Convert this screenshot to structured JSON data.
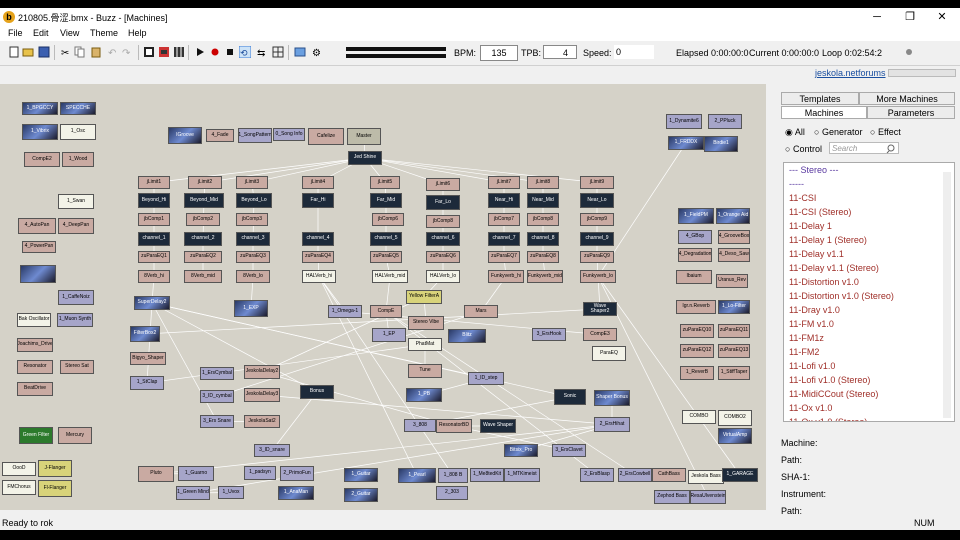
{
  "window": {
    "title": "210805.骨涩.bmx - Buzz - [Machines]",
    "minimize": "─",
    "maximize": "❐",
    "close": "✕"
  },
  "menu": [
    "File",
    "Edit",
    "View",
    "Theme",
    "Help"
  ],
  "toolbar": {
    "bpm_label": "BPM:",
    "bpm_value": "135",
    "tpb_label": "TPB:",
    "tpb_value": "4",
    "speed_label": "Speed:",
    "speed_value": "0",
    "elapsed": "Elapsed 0:00:00:0",
    "current": "Current 0:00:00:0",
    "loop": "Loop 0:02:54:2"
  },
  "links": {
    "site": "jeskola.net",
    "forums": "forums"
  },
  "panel": {
    "tabs_top": [
      "Templates",
      "More Machines"
    ],
    "tabs_bottom": [
      "Machines",
      "Parameters"
    ],
    "filters": [
      "All",
      "Generator",
      "Effect",
      "Control"
    ],
    "search_placeholder": "Search",
    "list": [
      "--- Stereo ---",
      "-----",
      "11-CSI",
      "11-CSI (Stereo)",
      "11-Delay 1",
      "11-Delay 1 (Stereo)",
      "11-Delay v1.1",
      "11-Delay v1.1 (Stereo)",
      "11-Distortion v1.0",
      "11-Distortion v1.0 (Stereo)",
      "11-Dray v1.0",
      "11-FM v1.0",
      "11-FM1z",
      "11-FM2",
      "11-Lofi v1.0",
      "11-Lofi v1.0 (Stereo)",
      "11-MidiCCout (Stereo)",
      "11-Ox v1.0",
      "11-Ox v1.0 (Stereo)"
    ],
    "info_labels": [
      "Machine:",
      "Path:",
      "SHA-1:",
      "Instrument:",
      "Path:"
    ]
  },
  "status": {
    "left": "Ready to rok",
    "right": "NUM"
  },
  "machines": [
    {
      "l": "1_BPGCCY",
      "k": "img"
    },
    {
      "l": "SPECCHE",
      "k": "img"
    },
    {
      "l": "1_Vibrix",
      "k": "img"
    },
    {
      "l": "1_Osc",
      "k": "wht"
    },
    {
      "l": "CompE2",
      "k": "eff"
    },
    {
      "l": "1_Wood",
      "k": "eff"
    },
    {
      "l": "1_Swan",
      "k": "wht"
    },
    {
      "l": "4_AutoPan",
      "k": "eff"
    },
    {
      "l": "4_DeepPan",
      "k": "eff"
    },
    {
      "l": "4_PowerPan",
      "k": "eff"
    },
    {
      "l": "",
      "k": "img"
    },
    {
      "l": "1_CaffeNoiz",
      "k": "gen"
    },
    {
      "l": "Bak Oscillator",
      "k": "wht"
    },
    {
      "l": "1_Muon Synth",
      "k": "gen"
    },
    {
      "l": "Joachims_Drive",
      "k": "eff"
    },
    {
      "l": "Resonator",
      "k": "eff"
    },
    {
      "l": "Stereo Sat",
      "k": "eff"
    },
    {
      "l": "BeatDrive",
      "k": "eff"
    },
    {
      "l": "Green Filter",
      "k": "grn"
    },
    {
      "l": "Mercury",
      "k": "eff"
    },
    {
      "l": "OooD",
      "k": "wht"
    },
    {
      "l": "J-Flanger",
      "k": "yel"
    },
    {
      "l": "FMChorus",
      "k": "wht"
    },
    {
      "l": "Fl-Flanger",
      "k": "yel"
    },
    {
      "l": "IGroove",
      "k": "img"
    },
    {
      "l": "4_Fade",
      "k": "eff"
    },
    {
      "l": "1_SongPattern",
      "k": "gen"
    },
    {
      "l": "0_Song Info",
      "k": "gen"
    },
    {
      "l": "Cafelize",
      "k": "eff"
    },
    {
      "l": "Master",
      "k": "mas"
    },
    {
      "l": "Jed Shine",
      "k": "dk"
    },
    {
      "l": "jLimit1",
      "k": "eff"
    },
    {
      "l": "jLimit2",
      "k": "eff"
    },
    {
      "l": "jLimit3",
      "k": "eff"
    },
    {
      "l": "jLimit4",
      "k": "eff"
    },
    {
      "l": "jLimit5",
      "k": "eff"
    },
    {
      "l": "jLimit6",
      "k": "eff"
    },
    {
      "l": "jLimit7",
      "k": "eff"
    },
    {
      "l": "jLimit8",
      "k": "eff"
    },
    {
      "l": "jLimit9",
      "k": "eff"
    },
    {
      "l": "Beyond_Hi",
      "k": "dk"
    },
    {
      "l": "Beyond_Mid",
      "k": "dk"
    },
    {
      "l": "Beyond_Lo",
      "k": "dk"
    },
    {
      "l": "Far_Hi",
      "k": "dk"
    },
    {
      "l": "Far_Mid",
      "k": "dk"
    },
    {
      "l": "Far_Lo",
      "k": "dk"
    },
    {
      "l": "Near_Hi",
      "k": "dk"
    },
    {
      "l": "Near_Mid",
      "k": "dk"
    },
    {
      "l": "Near_Lo",
      "k": "dk"
    },
    {
      "l": "jbComp1",
      "k": "eff"
    },
    {
      "l": "jbComp2",
      "k": "eff"
    },
    {
      "l": "jbComp3",
      "k": "eff"
    },
    {
      "l": "jbComp6",
      "k": "eff"
    },
    {
      "l": "jbComp8",
      "k": "eff"
    },
    {
      "l": "jbComp7",
      "k": "eff"
    },
    {
      "l": "jbComp8",
      "k": "eff"
    },
    {
      "l": "jbComp9",
      "k": "eff"
    },
    {
      "l": "channel_1",
      "k": "dk"
    },
    {
      "l": "channel_2",
      "k": "dk"
    },
    {
      "l": "channel_3",
      "k": "dk"
    },
    {
      "l": "channel_4",
      "k": "dk"
    },
    {
      "l": "channel_5",
      "k": "dk"
    },
    {
      "l": "channel_6",
      "k": "dk"
    },
    {
      "l": "channel_7",
      "k": "dk"
    },
    {
      "l": "channel_8",
      "k": "dk"
    },
    {
      "l": "channel_9",
      "k": "dk"
    },
    {
      "l": "zuParaEQ1",
      "k": "eff"
    },
    {
      "l": "zuParaEQ2",
      "k": "eff"
    },
    {
      "l": "zuParaEQ3",
      "k": "eff"
    },
    {
      "l": "zuParaEQ4",
      "k": "eff"
    },
    {
      "l": "zuParaEQ5",
      "k": "eff"
    },
    {
      "l": "zuParaEQ6",
      "k": "eff"
    },
    {
      "l": "zuParaEQ7",
      "k": "eff"
    },
    {
      "l": "zuParaEQ8",
      "k": "eff"
    },
    {
      "l": "zuParaEQ9",
      "k": "eff"
    },
    {
      "l": "8Verb_hi",
      "k": "eff"
    },
    {
      "l": "8Verb_mid",
      "k": "eff"
    },
    {
      "l": "8Verb_lo",
      "k": "eff"
    },
    {
      "l": "HALVerb_hi",
      "k": "wht"
    },
    {
      "l": "HALVerb_mid",
      "k": "wht"
    },
    {
      "l": "HALVerb_lo",
      "k": "wht"
    },
    {
      "l": "Funkyverb_hi",
      "k": "eff"
    },
    {
      "l": "Funkyverb_mid",
      "k": "eff"
    },
    {
      "l": "Funkyverb_lo",
      "k": "eff"
    },
    {
      "l": "SuperDelay2",
      "k": "img"
    },
    {
      "l": "1_EXP",
      "k": "img"
    },
    {
      "l": "1_Omega-1",
      "k": "gen"
    },
    {
      "l": "CompE",
      "k": "eff"
    },
    {
      "l": "Yellow FilterA",
      "k": "yel"
    },
    {
      "l": "Mars",
      "k": "eff"
    },
    {
      "l": "Wave Shaper2",
      "k": "dk"
    },
    {
      "l": "1_EP",
      "k": "gen"
    },
    {
      "l": "Stereo Vibe",
      "k": "eff"
    },
    {
      "l": "Blitz",
      "k": "img"
    },
    {
      "l": "3_ErsHook",
      "k": "gen"
    },
    {
      "l": "CompE3",
      "k": "eff"
    },
    {
      "l": "FilterBox2",
      "k": "img"
    },
    {
      "l": "Bigyo_Shaper",
      "k": "eff"
    },
    {
      "l": "1_StClap",
      "k": "gen"
    },
    {
      "l": "PhatMat",
      "k": "wht"
    },
    {
      "l": "Tune",
      "k": "eff"
    },
    {
      "l": "ParaEQ",
      "k": "wht"
    },
    {
      "l": "1_ErsCymbal",
      "k": "gen"
    },
    {
      "l": "JeskolaDelay2",
      "k": "eff"
    },
    {
      "l": "3_ID_cymbal",
      "k": "gen"
    },
    {
      "l": "JeskolaDelay3",
      "k": "eff"
    },
    {
      "l": "3_Ers Snare",
      "k": "gen"
    },
    {
      "l": "JeskolaSat2",
      "k": "eff"
    },
    {
      "l": "Bonus",
      "k": "dk"
    },
    {
      "l": "3_ID_snare",
      "k": "gen"
    },
    {
      "l": "1_ID_step",
      "k": "gen"
    },
    {
      "l": "1_PB",
      "k": "img"
    },
    {
      "l": "Sonic",
      "k": "dk"
    },
    {
      "l": "3_808",
      "k": "gen"
    },
    {
      "l": "ResonatorBD",
      "k": "eff"
    },
    {
      "l": "Wave Shaper",
      "k": "dk"
    },
    {
      "l": "2_ErsHihat",
      "k": "gen"
    },
    {
      "l": "Shaper Bonus",
      "k": "img"
    },
    {
      "l": "3_ErsClavet",
      "k": "gen"
    },
    {
      "l": "Bitsix_Pro",
      "k": "img"
    },
    {
      "l": "Pluto",
      "k": "eff"
    },
    {
      "l": "1_Guarno",
      "k": "gen"
    },
    {
      "l": "1_Green Mind",
      "k": "gen"
    },
    {
      "l": "1_Uvox",
      "k": "gen"
    },
    {
      "l": "1_padsyn",
      "k": "gen"
    },
    {
      "l": "2_PrimoFun",
      "k": "gen"
    },
    {
      "l": "1_AnaMan",
      "k": "img"
    },
    {
      "l": "1_Guitar",
      "k": "img"
    },
    {
      "l": "2_Guitar",
      "k": "img"
    },
    {
      "l": "1_Pearl",
      "k": "img"
    },
    {
      "l": "1_808 B",
      "k": "gen"
    },
    {
      "l": "1_Me8tedKit",
      "k": "gen"
    },
    {
      "l": "1_MTKimeist",
      "k": "gen"
    },
    {
      "l": "2_303",
      "k": "gen"
    },
    {
      "l": "2_ErsBlasp",
      "k": "gen"
    },
    {
      "l": "2_ErsCowbell",
      "k": "gen"
    },
    {
      "l": "CathBass",
      "k": "eff"
    },
    {
      "l": "Jeskola Bass",
      "k": "wht"
    },
    {
      "l": "1_GARAGE",
      "k": "dk"
    },
    {
      "l": "Zephod Bass",
      "k": "gen"
    },
    {
      "l": "ResaUlvenstein",
      "k": "gen"
    },
    {
      "l": "1_Dynamite6",
      "k": "gen"
    },
    {
      "l": "2_PPluck",
      "k": "gen"
    },
    {
      "l": "1_FRDDX",
      "k": "img"
    },
    {
      "l": "Birdie1",
      "k": "img"
    },
    {
      "l": "1_FieldPM",
      "k": "img"
    },
    {
      "l": "1_Orange Aid",
      "k": "img"
    },
    {
      "l": "4_GBop",
      "k": "gen"
    },
    {
      "l": "4_GrooveBox",
      "k": "eff"
    },
    {
      "l": "4_Degradation",
      "k": "eff"
    },
    {
      "l": "4_Deso_Saw",
      "k": "eff"
    },
    {
      "l": "Ibaium",
      "k": "eff"
    },
    {
      "l": "Uranus_Rev",
      "k": "eff"
    },
    {
      "l": "Igr.n.Reverb",
      "k": "eff"
    },
    {
      "l": "1_Lo-Filter",
      "k": "img"
    },
    {
      "l": "zuParaEQ10",
      "k": "eff"
    },
    {
      "l": "zuParaEQ11",
      "k": "eff"
    },
    {
      "l": "zuParaEQ12",
      "k": "eff"
    },
    {
      "l": "zuParaEQ13",
      "k": "eff"
    },
    {
      "l": "1_ReverB",
      "k": "eff"
    },
    {
      "l": "1_StiffTaper",
      "k": "eff"
    },
    {
      "l": "COMBO",
      "k": "wht"
    },
    {
      "l": "COMBO2",
      "k": "wht"
    },
    {
      "l": "VirtualAmp",
      "k": "img"
    }
  ]
}
